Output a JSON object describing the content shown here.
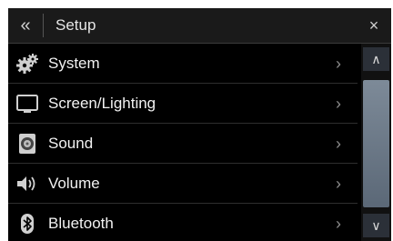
{
  "header": {
    "back_icon": "«",
    "title": "Setup",
    "close_icon": "×"
  },
  "menu": {
    "items": [
      {
        "label": "System",
        "icon": "gears-icon"
      },
      {
        "label": "Screen/Lighting",
        "icon": "monitor-icon"
      },
      {
        "label": "Sound",
        "icon": "speaker-icon"
      },
      {
        "label": "Volume",
        "icon": "volume-icon"
      },
      {
        "label": "Bluetooth",
        "icon": "bluetooth-icon"
      }
    ],
    "chevron": "›"
  },
  "scrollbar": {
    "up_icon": "∧",
    "down_icon": "∨"
  },
  "colors": {
    "background": "#000000",
    "header": "#1a1a1a",
    "scroll_thumb": "#6b7888"
  }
}
